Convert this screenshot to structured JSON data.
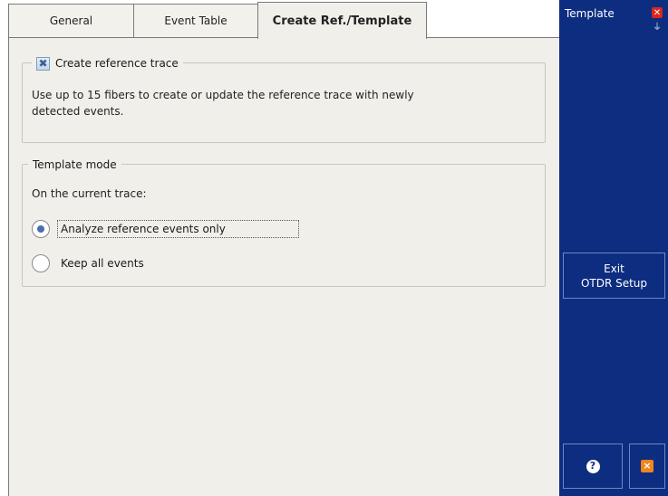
{
  "tabs": [
    {
      "label": "General",
      "active": false
    },
    {
      "label": "Event Table",
      "active": false
    },
    {
      "label": "Create Ref./Template",
      "active": true
    }
  ],
  "reference_group": {
    "checkbox_label": "Create reference trace",
    "checked": true,
    "description_line1": "Use up to 15 fibers to create or update the reference trace with newly",
    "description_line2": "detected events."
  },
  "template_group": {
    "title": "Template mode",
    "prompt": "On the current trace:",
    "options": [
      {
        "label": "Analyze reference events only",
        "selected": true
      },
      {
        "label": "Keep all events",
        "selected": false
      }
    ]
  },
  "sidebar": {
    "title": "Template",
    "exit_line1": "Exit",
    "exit_line2": "OTDR Setup",
    "help_glyph": "?",
    "close_glyph": "×"
  },
  "colors": {
    "sidebar_bg": "#0d2d80",
    "panel_bg": "#f0efea",
    "accent_close": "#f0851e"
  }
}
